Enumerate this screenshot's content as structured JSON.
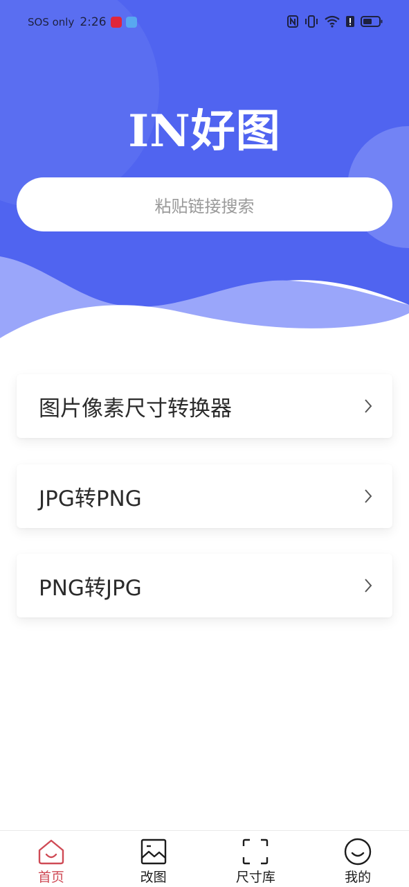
{
  "status_bar": {
    "carrier": "SOS only",
    "time": "2:26"
  },
  "header": {
    "brand": "IN好图",
    "search_placeholder": "粘贴链接搜索"
  },
  "colors": {
    "hero_blue": "#5064f0",
    "active_tab": "#cf4a55"
  },
  "menu": [
    {
      "label": "图片像素尺寸转换器",
      "icon": "chevron-right-icon"
    },
    {
      "label": "JPG转PNG",
      "icon": "chevron-right-icon"
    },
    {
      "label": "PNG转JPG",
      "icon": "chevron-right-icon"
    }
  ],
  "tabs": [
    {
      "label": "首页",
      "icon": "home-icon",
      "active": true
    },
    {
      "label": "改图",
      "icon": "image-icon",
      "active": false
    },
    {
      "label": "尺寸库",
      "icon": "scan-frame-icon",
      "active": false
    },
    {
      "label": "我的",
      "icon": "smiley-icon",
      "active": false
    }
  ]
}
